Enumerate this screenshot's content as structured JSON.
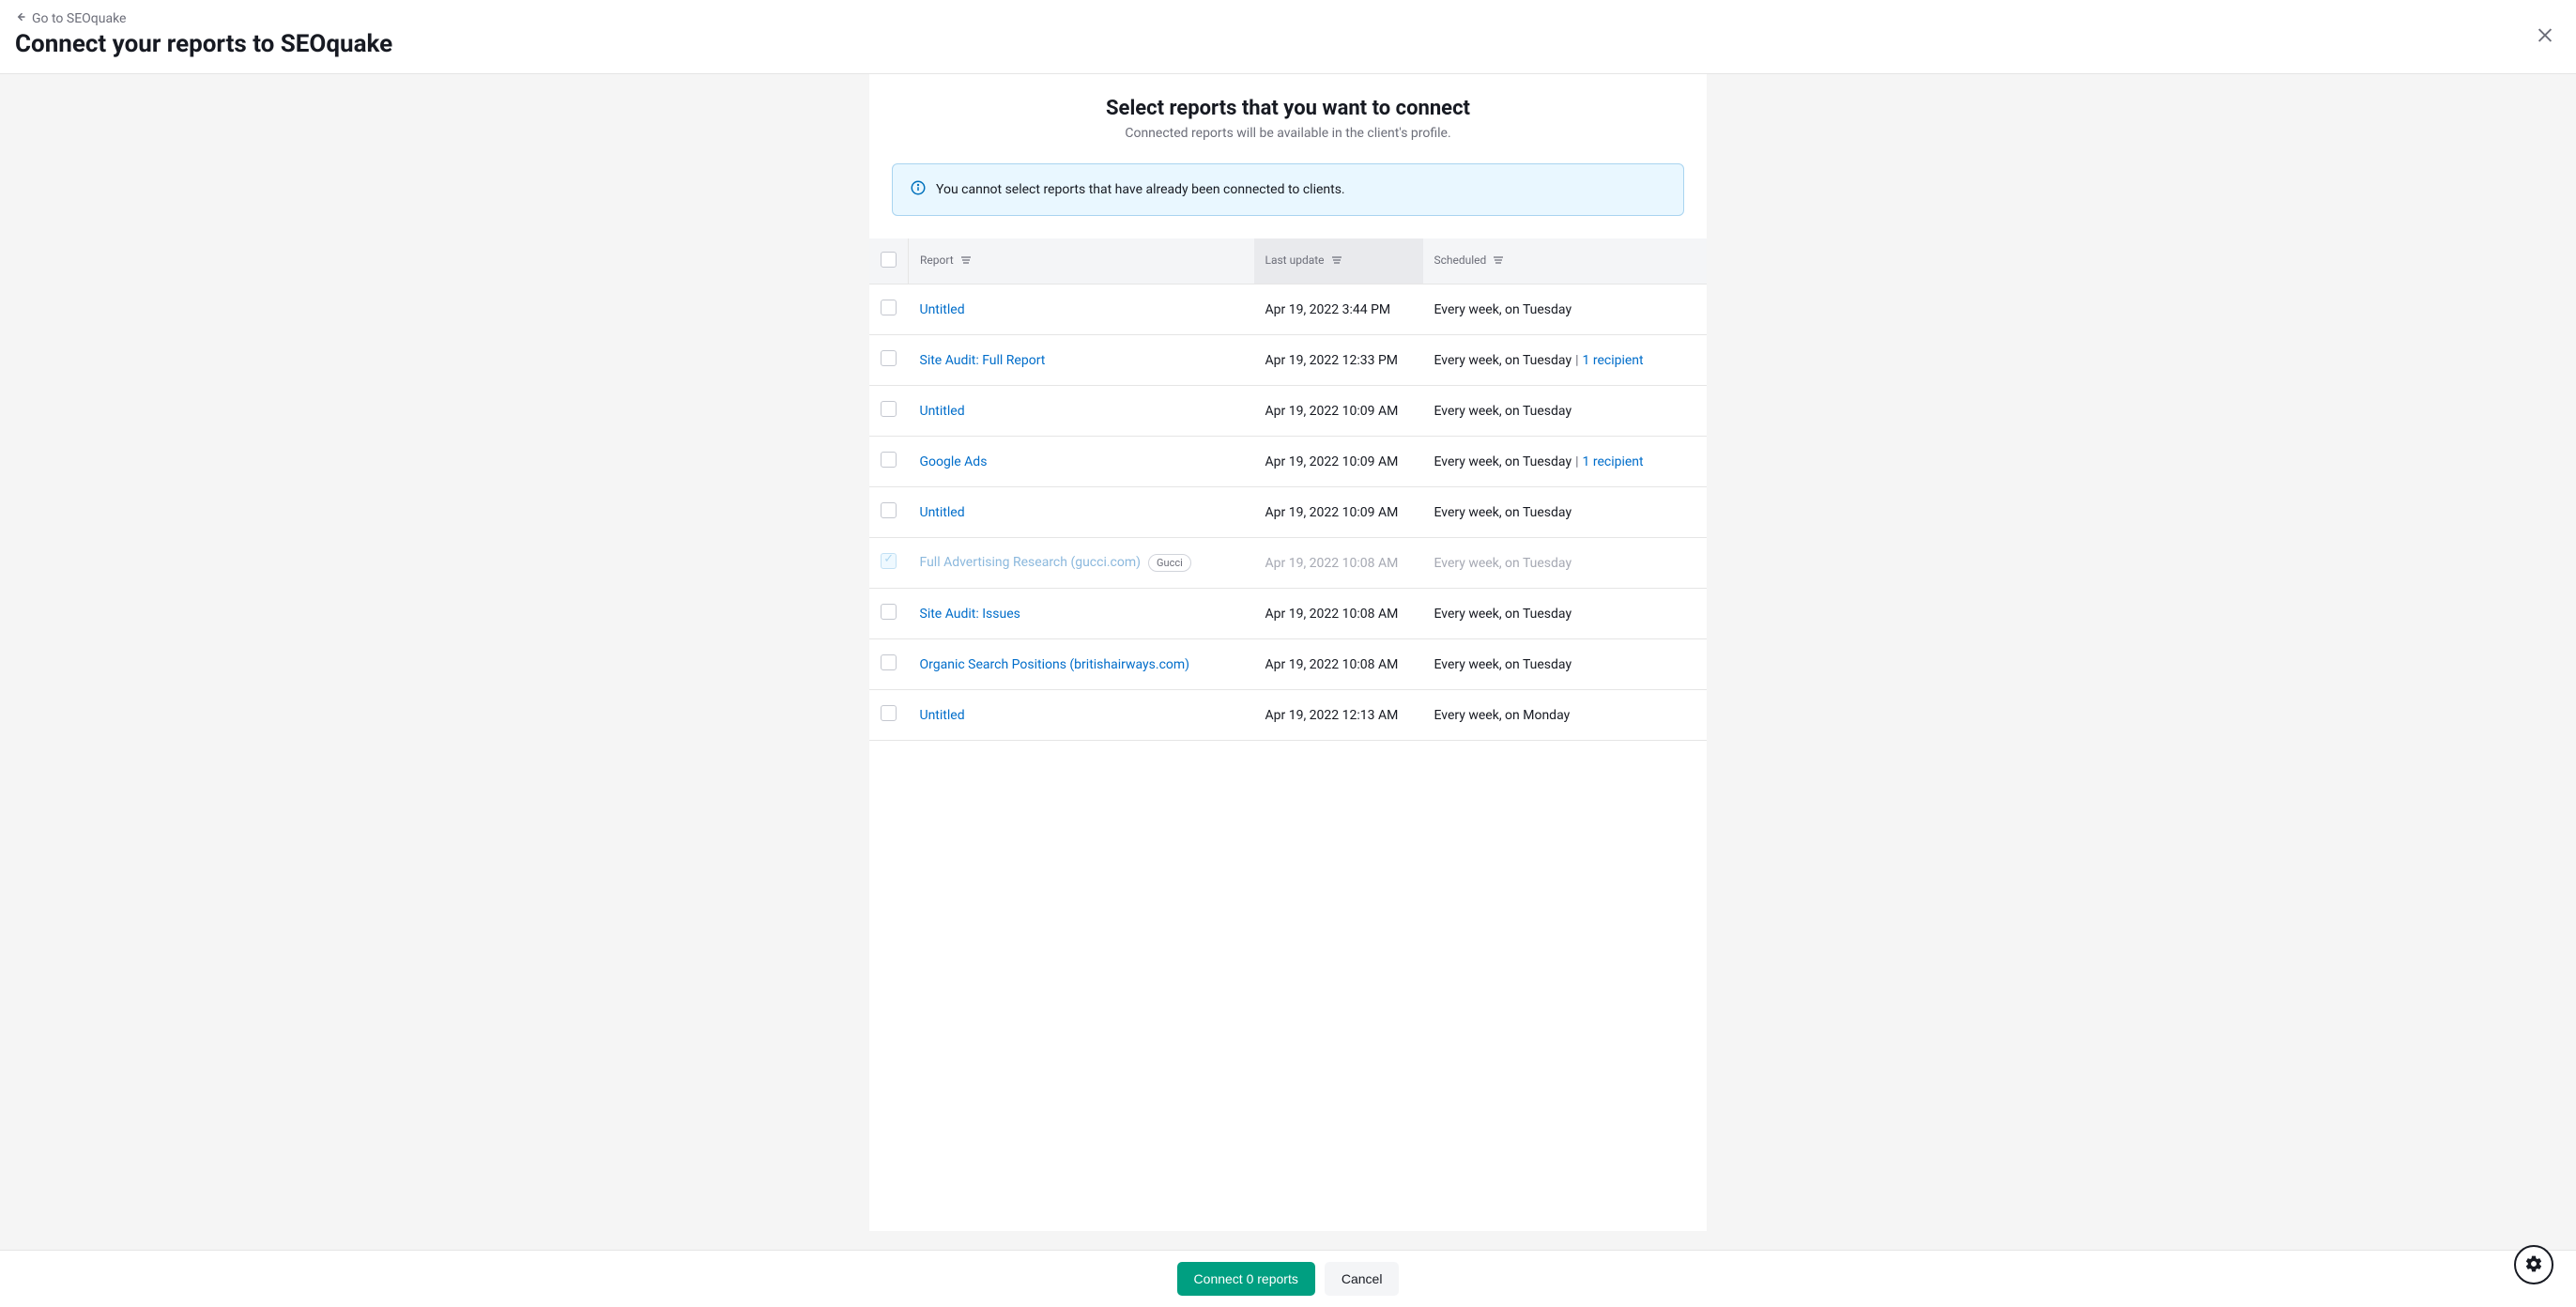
{
  "header": {
    "back_label": "Go to SEOquake",
    "page_title": "Connect your reports to SEOquake"
  },
  "panel": {
    "title": "Select reports that you want to connect",
    "subtitle": "Connected reports will be available in the client's profile.",
    "info_text": "You cannot select reports that have already been connected to clients."
  },
  "table": {
    "headers": {
      "report": "Report",
      "last_update": "Last update",
      "scheduled": "Scheduled"
    },
    "rows": [
      {
        "name": "Untitled",
        "update": "Apr 19, 2022 3:44 PM",
        "schedule": "Every week, on Tuesday",
        "recipients": null,
        "tag": null,
        "disabled": false
      },
      {
        "name": "Site Audit: Full Report",
        "update": "Apr 19, 2022 12:33 PM",
        "schedule": "Every week, on Tuesday",
        "recipients": "1 recipient",
        "tag": null,
        "disabled": false
      },
      {
        "name": "Untitled",
        "update": "Apr 19, 2022 10:09 AM",
        "schedule": "Every week, on Tuesday",
        "recipients": null,
        "tag": null,
        "disabled": false
      },
      {
        "name": "Google Ads",
        "update": "Apr 19, 2022 10:09 AM",
        "schedule": "Every week, on Tuesday",
        "recipients": "1 recipient",
        "tag": null,
        "disabled": false
      },
      {
        "name": "Untitled",
        "update": "Apr 19, 2022 10:09 AM",
        "schedule": "Every week, on Tuesday",
        "recipients": null,
        "tag": null,
        "disabled": false
      },
      {
        "name": "Full Advertising Research (gucci.com)",
        "update": "Apr 19, 2022 10:08 AM",
        "schedule": "Every week, on Tuesday",
        "recipients": null,
        "tag": "Gucci",
        "disabled": true
      },
      {
        "name": "Site Audit: Issues",
        "update": "Apr 19, 2022 10:08 AM",
        "schedule": "Every week, on Tuesday",
        "recipients": null,
        "tag": null,
        "disabled": false
      },
      {
        "name": "Organic Search Positions (britishairways.com)",
        "update": "Apr 19, 2022 10:08 AM",
        "schedule": "Every week, on Tuesday",
        "recipients": null,
        "tag": null,
        "disabled": false
      },
      {
        "name": "Untitled",
        "update": "Apr 19, 2022 12:13 AM",
        "schedule": "Every week, on Monday",
        "recipients": null,
        "tag": null,
        "disabled": false
      }
    ]
  },
  "footer": {
    "connect_label": "Connect 0 reports",
    "cancel_label": "Cancel"
  }
}
